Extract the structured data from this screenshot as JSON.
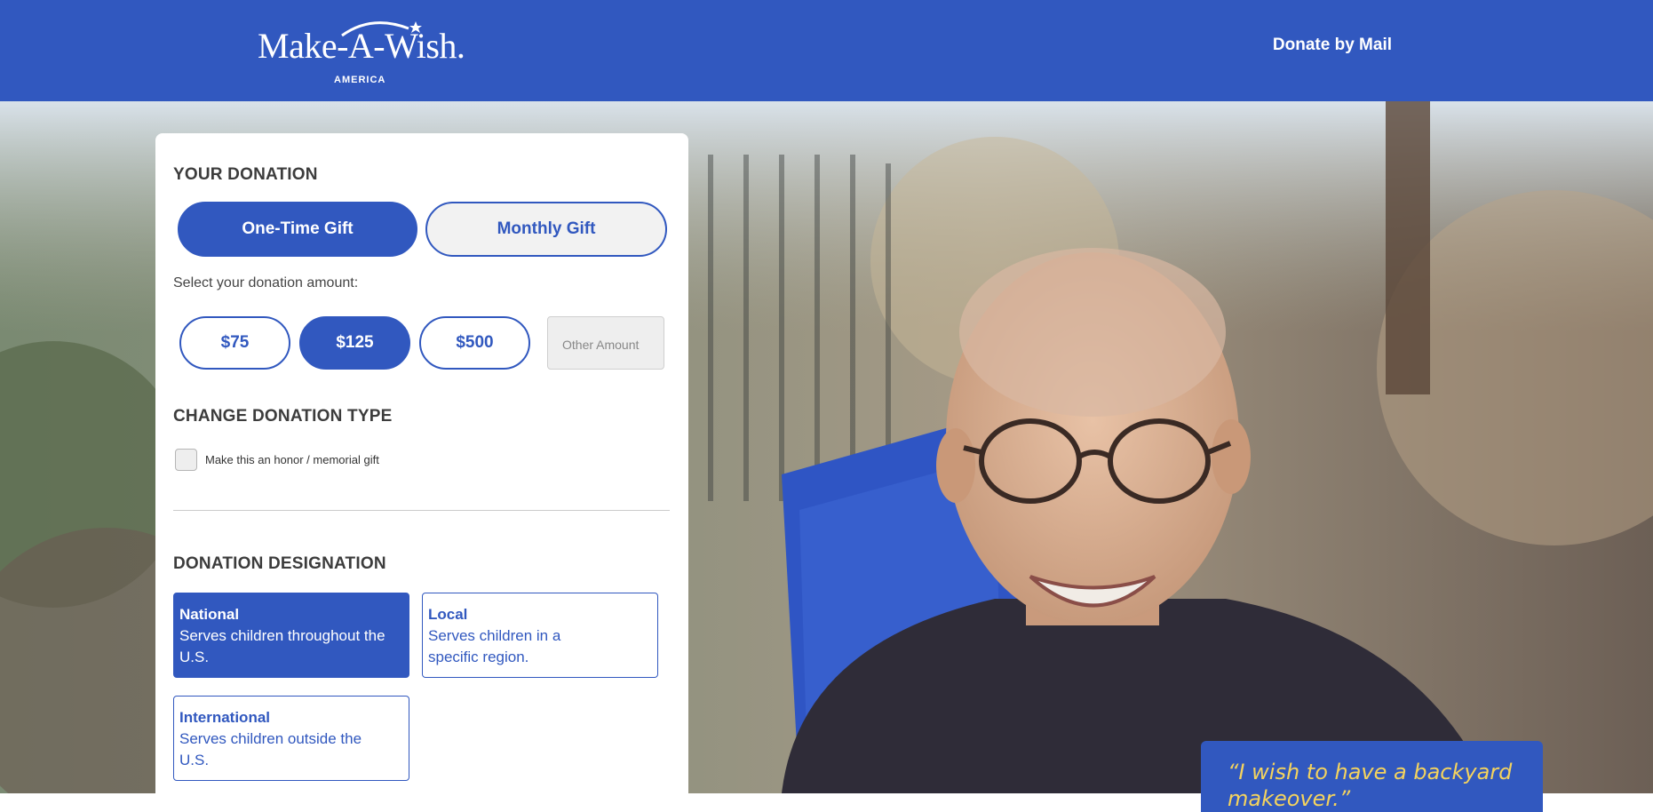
{
  "header": {
    "logo_text": "Make-A-Wish.",
    "logo_subtext": "AMERICA",
    "donate_by_mail": "Donate by Mail"
  },
  "donation": {
    "title": "YOUR DONATION",
    "gift_types": [
      {
        "label": "One-Time Gift",
        "selected": true
      },
      {
        "label": "Monthly Gift",
        "selected": false
      }
    ],
    "select_amount_label": "Select your donation amount:",
    "amounts": [
      {
        "label": "$75",
        "selected": false
      },
      {
        "label": "$125",
        "selected": true
      },
      {
        "label": "$500",
        "selected": false
      }
    ],
    "other_amount_placeholder": "Other Amount"
  },
  "change_type": {
    "title": "CHANGE DONATION TYPE",
    "honor_checkbox_label": "Make this an honor / memorial gift",
    "honor_checked": false
  },
  "designation": {
    "title": "DONATION DESIGNATION",
    "options": [
      {
        "name": "National",
        "description": "Serves children throughout the U.S.",
        "selected": true
      },
      {
        "name": "Local",
        "description": "Serves children in a specific region.",
        "selected": false
      },
      {
        "name": "International",
        "description": "Serves children outside the U.S.",
        "selected": false
      }
    ]
  },
  "quote": {
    "text": "“I wish to have a backyard makeover.”"
  },
  "colors": {
    "brand_blue": "#3158bf",
    "quote_yellow": "#f4d35e"
  }
}
